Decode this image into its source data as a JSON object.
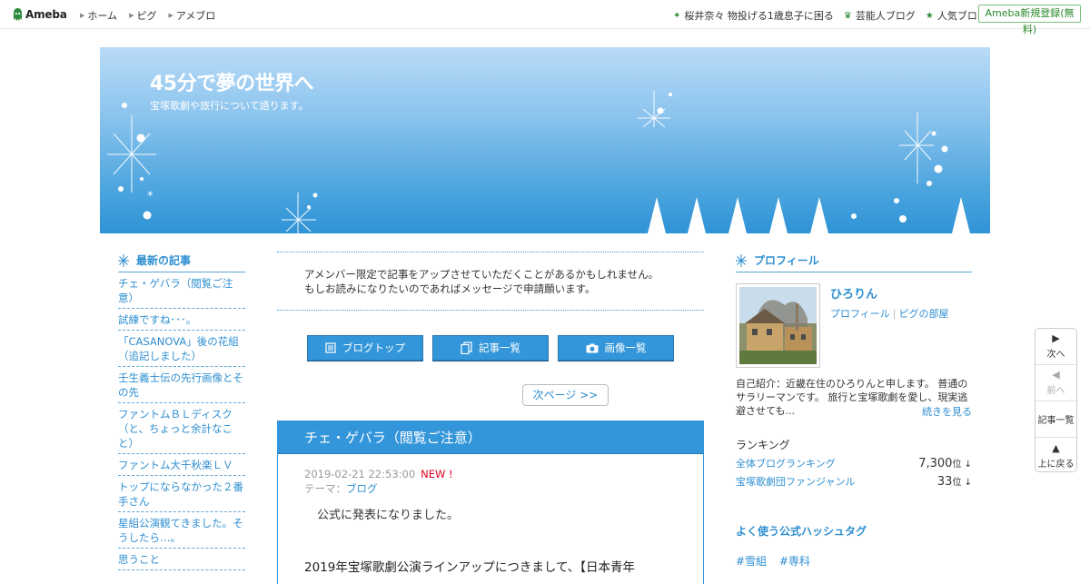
{
  "topbar": {
    "logo_text": "Ameba",
    "nav": [
      "ホーム",
      "ピグ",
      "アメブロ"
    ],
    "links": [
      {
        "icon": "clover-icon",
        "label": "桜井奈々 物投げる1歳息子に困る"
      },
      {
        "icon": "crown-icon",
        "label": "芸能人ブログ"
      },
      {
        "icon": "star-icon",
        "label": "人気ブログ"
      }
    ],
    "register_label": "Ameba新規登録(無料)"
  },
  "header": {
    "title": "45分で夢の世界へ",
    "subtitle": "宝塚歌劇や旅行について語ります。"
  },
  "left_sidebar": {
    "heading": "最新の記事",
    "items": [
      "チェ・ゲバラ（閲覧ご注意）",
      "試練ですね･･･。",
      "「CASANOVA」後の花組（追記しました）",
      "壬生義士伝の先行画像とその先",
      "ファントムＢＬディスク（と、ちょっと余計なこと）",
      "ファントム大千秋楽ＬＶ",
      "トップにならなかった２番手さん",
      "星組公演観てきました。そうしたら…。",
      "思うこと"
    ]
  },
  "main": {
    "notice_line1": "アメンバー限定で記事をアップさせていただくことがあるかもしれません。",
    "notice_line2": "もしお読みになりたいのであればメッセージで申請願います。",
    "buttons": {
      "blog_top": "ブログトップ",
      "entry_list": "記事一覧",
      "image_list": "画像一覧"
    },
    "next_page": "次ページ >>",
    "entry": {
      "title": "チェ・ゲバラ（閲覧ご注意）",
      "datetime": "2019-02-21 22:53:00",
      "new_badge": "NEW !",
      "theme_label": "テーマ：",
      "theme": "ブログ",
      "line1": "公式に発表になりました。",
      "line2": "2019年宝塚歌劇公演ラインアップにつきまして、【日本青年"
    }
  },
  "right_sidebar": {
    "heading": "プロフィール",
    "name": "ひろりん",
    "link_profile": "プロフィール",
    "link_pigg": "ピグの部屋",
    "intro": "自己紹介：近畿在住のひろりんと申します。 普通のサラリーマンです。 旅行と宝塚歌劇を愛し、現実逃避させても...",
    "more": "続きを見る",
    "ranking_heading": "ランキング",
    "rankings": [
      {
        "name": "全体ブログランキング",
        "value": "7,300",
        "unit": "位 ↓"
      },
      {
        "name": "宝塚歌劇団ファンジャンル",
        "value": "33",
        "unit": "位 ↓"
      }
    ],
    "hashtag_heading": "よく使う公式ハッシュタグ",
    "hashtags": [
      "#雪組",
      "#専科"
    ]
  },
  "floating_nav": {
    "next": "次へ",
    "prev": "前へ",
    "list": "記事一覧",
    "top": "上に戻る"
  },
  "colors": {
    "accent": "#3496da",
    "link": "#2f8fd1",
    "ameba_green": "#2e8b3c",
    "new_red": "#e0001c"
  }
}
